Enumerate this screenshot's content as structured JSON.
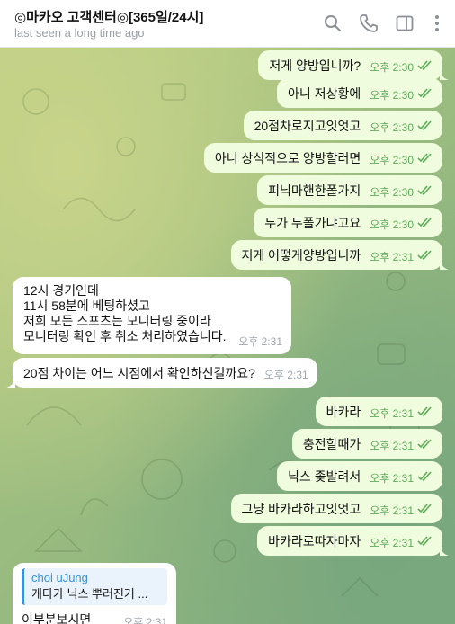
{
  "header": {
    "title": "◎마카오 고객센터◎[365일/24시]",
    "status": "last seen a long time ago",
    "icons": [
      "search-icon",
      "phone-icon",
      "sidebar-icon",
      "more-icon"
    ]
  },
  "messages": [
    {
      "dir": "out",
      "text": "저게 양방입니까?",
      "time": "오후 2:30"
    },
    {
      "dir": "out",
      "text": "아니 저상황에",
      "time": "오후 2:30"
    },
    {
      "dir": "out",
      "text": "20점차로지고잇엇고",
      "time": "오후 2:30"
    },
    {
      "dir": "out",
      "text": "아니 상식적으로 양방할러면",
      "time": "오후 2:30"
    },
    {
      "dir": "out",
      "text": "피닉마핸한폴가지",
      "time": "오후 2:30"
    },
    {
      "dir": "out",
      "text": "두가 두폴가냐고요",
      "time": "오후 2:30"
    },
    {
      "dir": "out",
      "text": "저게 어떻게양방입니까",
      "time": "오후 2:31"
    },
    {
      "dir": "in",
      "lines": [
        "12시 경기인데",
        "11시 58분에 베팅하셨고",
        "저희 모든 스포츠는 모니터링 중이라",
        "모니터링 확인 후 취소 처리하였습니다."
      ],
      "time": "오후 2:31"
    },
    {
      "dir": "in",
      "text": "20점 차이는 어느 시점에서 확인하신걸까요?",
      "time": "오후 2:31"
    },
    {
      "dir": "out",
      "text": "바카라",
      "time": "오후 2:31"
    },
    {
      "dir": "out",
      "text": "충전할때가",
      "time": "오후 2:31"
    },
    {
      "dir": "out",
      "text": "닉스 좆발려서",
      "time": "오후 2:31"
    },
    {
      "dir": "out",
      "text": "그냥 바카라하고잇엇고",
      "time": "오후 2:31"
    },
    {
      "dir": "out",
      "text": "바카라로따자마자",
      "time": "오후 2:31"
    },
    {
      "dir": "in",
      "reply_author": "choi uJung",
      "reply_text": "게다가 닉스 뿌러진거 ...",
      "text": "이부분보시면",
      "time": "오후 2:31"
    }
  ]
}
